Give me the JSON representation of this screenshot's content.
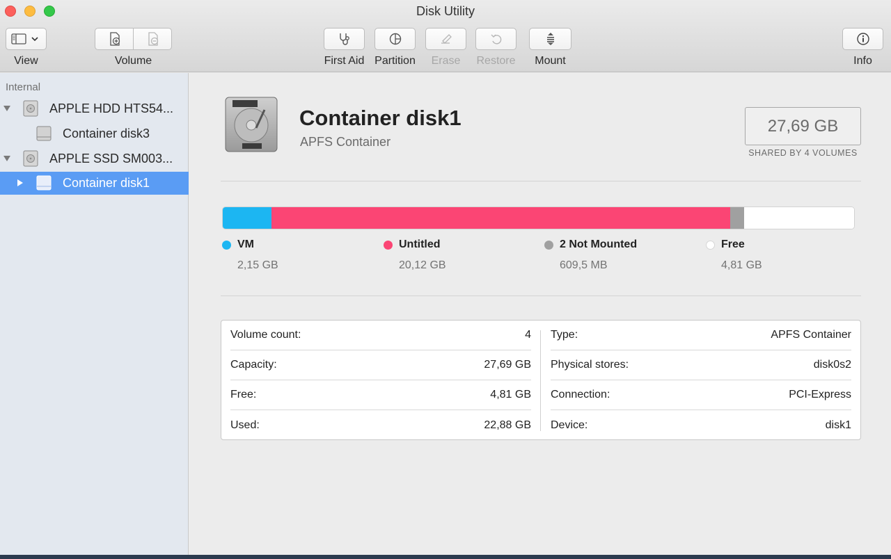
{
  "window": {
    "title": "Disk Utility"
  },
  "toolbar": {
    "view_label": "View",
    "volume_label": "Volume",
    "first_aid_label": "First Aid",
    "partition_label": "Partition",
    "erase_label": "Erase",
    "restore_label": "Restore",
    "mount_label": "Mount",
    "info_label": "Info"
  },
  "sidebar": {
    "section": "Internal",
    "items": [
      {
        "label": "APPLE HDD HTS54...",
        "type": "disk",
        "expanded": true
      },
      {
        "label": "Container disk3",
        "type": "container"
      },
      {
        "label": "APPLE SSD SM003...",
        "type": "disk",
        "expanded": true
      },
      {
        "label": "Container disk1",
        "type": "container",
        "selected": true
      }
    ]
  },
  "main": {
    "title": "Container disk1",
    "subtitle": "APFS Container",
    "size": "27,69 GB",
    "size_caption": "SHARED BY 4 VOLUMES"
  },
  "usage": {
    "segments": [
      {
        "name": "VM",
        "size": "2,15 GB",
        "color": "#1cb6f2",
        "gb": 2.15
      },
      {
        "name": "Untitled",
        "size": "20,12 GB",
        "color": "#fb4574",
        "gb": 20.12
      },
      {
        "name": "2 Not Mounted",
        "size": "609,5 MB",
        "color": "#a0a0a0",
        "gb": 0.6095
      },
      {
        "name": "Free",
        "size": "4,81 GB",
        "color": "#ffffff",
        "gb": 4.81
      }
    ],
    "total_gb": 27.69
  },
  "details": {
    "left": [
      {
        "label": "Volume count:",
        "value": "4"
      },
      {
        "label": "Capacity:",
        "value": "27,69 GB"
      },
      {
        "label": "Free:",
        "value": "4,81 GB"
      },
      {
        "label": "Used:",
        "value": "22,88 GB"
      }
    ],
    "right": [
      {
        "label": "Type:",
        "value": "APFS Container"
      },
      {
        "label": "Physical stores:",
        "value": "disk0s2"
      },
      {
        "label": "Connection:",
        "value": "PCI-Express"
      },
      {
        "label": "Device:",
        "value": "disk1"
      }
    ]
  }
}
